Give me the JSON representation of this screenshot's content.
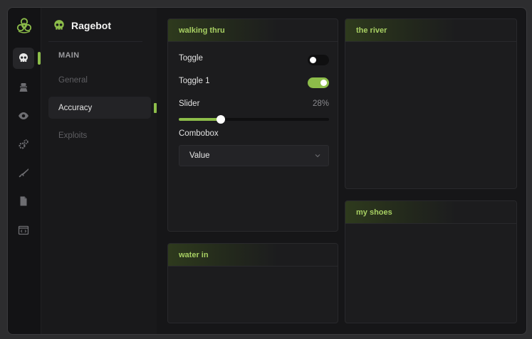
{
  "brand": {
    "title": "Ragebot",
    "icon": "skull-icon",
    "accent": "#8dbd4a"
  },
  "rail": {
    "logo": "biohazard-icon",
    "items": [
      {
        "icon": "skull-icon",
        "active": true
      },
      {
        "icon": "turret-icon",
        "active": false
      },
      {
        "icon": "eye-icon",
        "active": false
      },
      {
        "icon": "gears-icon",
        "active": false
      },
      {
        "icon": "rifle-icon",
        "active": false
      },
      {
        "icon": "file-icon",
        "active": false
      },
      {
        "icon": "code-window-icon",
        "active": false
      }
    ]
  },
  "nav": {
    "section": "MAIN",
    "items": [
      {
        "label": "General",
        "active": false
      },
      {
        "label": "Accuracy",
        "active": true
      },
      {
        "label": "Exploits",
        "active": false
      }
    ]
  },
  "panels": {
    "walking": {
      "title": "walking thru",
      "toggle": {
        "label": "Toggle",
        "on": false
      },
      "toggle1": {
        "label": "Toggle 1",
        "on": true
      },
      "slider": {
        "label": "Slider",
        "value": "28%",
        "fraction": 0.28
      },
      "combobox": {
        "label": "Combobox",
        "value": "Value"
      }
    },
    "river": {
      "title": "the river"
    },
    "water": {
      "title": "water in"
    },
    "shoes": {
      "title": "my shoes"
    }
  }
}
